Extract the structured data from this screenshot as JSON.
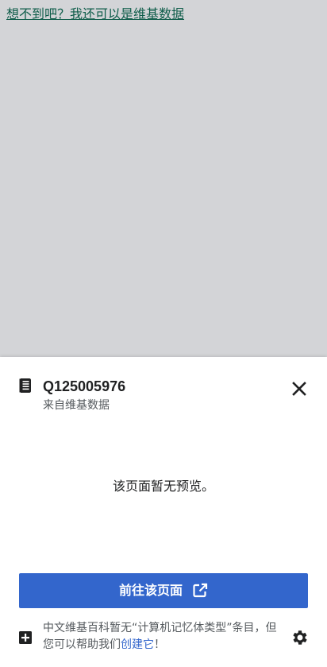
{
  "background": {
    "link_text": "想不到吧？我还可以是维基数据"
  },
  "preview": {
    "book_icon": "book-icon",
    "title": "Q125005976",
    "subtitle": "来自维基数据",
    "close_icon": "close-icon",
    "no_preview_text": "该页面暂无预览。",
    "go_button_label": "前往该页面",
    "go_button_icon": "external-link-icon",
    "footer": {
      "add_icon": "add-page-icon",
      "text_before": "中文维基百科暂无“计算机记忆体类型”条目，但您可以帮助我们",
      "link_text": "创建它",
      "text_after": "！"
    },
    "settings_icon": "gear-icon"
  },
  "colors": {
    "overlay": "#d3d4d7",
    "link_green": "#0f5d4a",
    "accent_blue": "#3366cc",
    "text_dark": "#202122",
    "text_muted": "#54595d"
  }
}
